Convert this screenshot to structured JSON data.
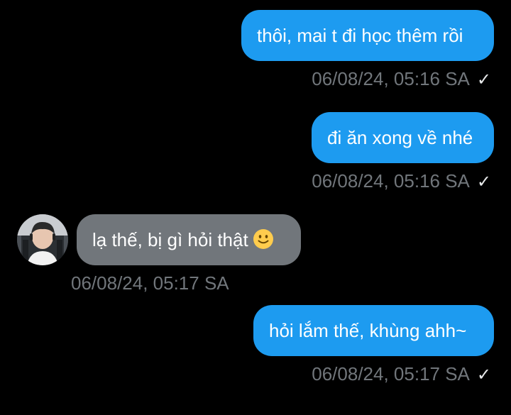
{
  "conversation": {
    "messages": [
      {
        "direction": "outgoing",
        "text": "thôi, mai t đi học thêm rồi",
        "timestamp": "06/08/24, 05:16 SA",
        "status_icon": "check-icon"
      },
      {
        "direction": "outgoing",
        "text": "đi ăn xong về nhé",
        "timestamp": "06/08/24, 05:16 SA",
        "status_icon": "check-icon"
      },
      {
        "direction": "incoming",
        "text": "lạ thế, bị gì hỏi thật",
        "emoji": "slightly-smiling-face-icon",
        "timestamp": "06/08/24, 05:17 SA"
      },
      {
        "direction": "outgoing",
        "text": "hỏi lắm thế, khùng ahh~",
        "timestamp": "06/08/24, 05:17 SA",
        "status_icon": "check-icon"
      }
    ]
  },
  "colors": {
    "background": "#000000",
    "outgoing_bubble": "#1d9bf0",
    "incoming_bubble": "#71767b",
    "timestamp": "#71767b"
  }
}
